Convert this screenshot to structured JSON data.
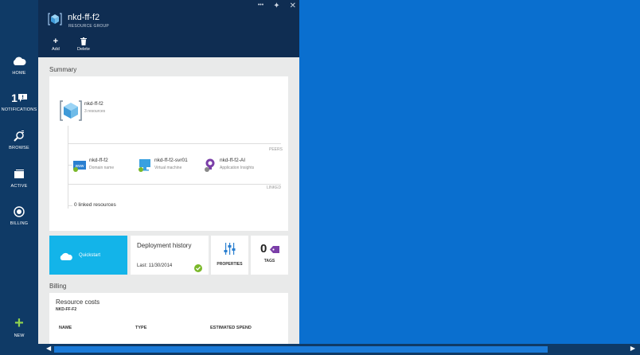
{
  "nav": {
    "home": "HOME",
    "notifications_count": "1",
    "notifications": "NOTIFICATIONS",
    "browse": "BROWSE",
    "active": "ACTIVE",
    "billing": "BILLING",
    "new": "NEW"
  },
  "blade": {
    "title": "nkd-ff-f2",
    "subtitle": "RESOURCE GROUP",
    "more": "•••",
    "pin": "✦",
    "close": "✕",
    "commands": {
      "add": "Add",
      "delete": "Delete"
    }
  },
  "summary": {
    "section_title": "Summary",
    "group_name": "nkd-ff-f2",
    "group_sub": "3 resources",
    "peers_label": "PEERS",
    "linked_label": "LINKED",
    "resources": [
      {
        "name": "nkd-ff-f2",
        "type": "Domain name"
      },
      {
        "name": "nkd-ff-f2-svr01",
        "type": "Virtual machine"
      },
      {
        "name": "nkd-ff-f2-AI",
        "type": "Application Insights"
      }
    ],
    "linked_resources": "0 linked resources"
  },
  "tiles": {
    "quickstart": "Quickstart",
    "deployment_title": "Deployment history",
    "deployment_last": "Last: 11/30/2014",
    "properties": "PROPERTIES",
    "tags_count": "0",
    "tags": "TAGS"
  },
  "billing": {
    "section_title": "Billing",
    "card_title": "Resource costs",
    "card_sub": "NKD-FF-F2",
    "columns": [
      "NAME",
      "TYPE",
      "ESTIMATED SPEND"
    ]
  },
  "colors": {
    "nav_bg": "#0f3a66",
    "header_bg": "#0f2d52",
    "desktop_bg": "#0a6fcf",
    "accent_green": "#8fd14f",
    "quickstart_bg": "#13b4e9"
  }
}
